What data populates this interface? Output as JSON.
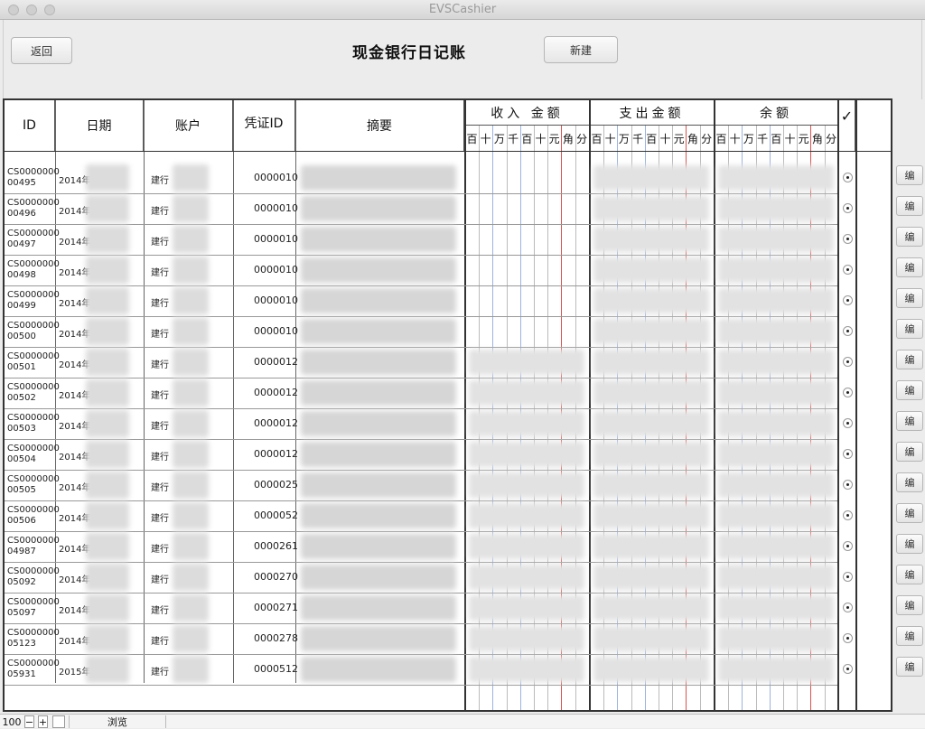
{
  "window": {
    "title": "EVSCashier"
  },
  "toolbar": {
    "back_label": "返回",
    "new_label": "新建",
    "page_title": "现金银行日记账"
  },
  "table": {
    "headers": {
      "id": "ID",
      "date": "日期",
      "account": "账户",
      "voucher": "凭证ID",
      "summary": "摘要",
      "check": "✓"
    },
    "groups": {
      "income": "收入 金额",
      "expense": "支出金额",
      "balance": "余额"
    },
    "digit_labels": [
      "百",
      "十",
      "万",
      "千",
      "百",
      "十",
      "元",
      "角",
      "分"
    ],
    "rows": [
      {
        "id_line1": "CS0000000",
        "id_line2": "00495",
        "date": "2014年",
        "account": "建行",
        "voucher": "0000010"
      },
      {
        "id_line1": "CS0000000",
        "id_line2": "00496",
        "date": "2014年",
        "account": "建行",
        "voucher": "0000010"
      },
      {
        "id_line1": "CS0000000",
        "id_line2": "00497",
        "date": "2014年",
        "account": "建行",
        "voucher": "0000010"
      },
      {
        "id_line1": "CS0000000",
        "id_line2": "00498",
        "date": "2014年",
        "account": "建行",
        "voucher": "0000010"
      },
      {
        "id_line1": "CS0000000",
        "id_line2": "00499",
        "date": "2014年",
        "account": "建行",
        "voucher": "0000010"
      },
      {
        "id_line1": "CS0000000",
        "id_line2": "00500",
        "date": "2014年",
        "account": "建行",
        "voucher": "0000010"
      },
      {
        "id_line1": "CS0000000",
        "id_line2": "00501",
        "date": "2014年",
        "account": "建行",
        "voucher": "0000012"
      },
      {
        "id_line1": "CS0000000",
        "id_line2": "00502",
        "date": "2014年",
        "account": "建行",
        "voucher": "0000012"
      },
      {
        "id_line1": "CS0000000",
        "id_line2": "00503",
        "date": "2014年",
        "account": "建行",
        "voucher": "0000012"
      },
      {
        "id_line1": "CS0000000",
        "id_line2": "00504",
        "date": "2014年",
        "account": "建行",
        "voucher": "0000012"
      },
      {
        "id_line1": "CS0000000",
        "id_line2": "00505",
        "date": "2014年",
        "account": "建行",
        "voucher": "0000025"
      },
      {
        "id_line1": "CS0000000",
        "id_line2": "00506",
        "date": "2014年",
        "account": "建行",
        "voucher": "0000052"
      },
      {
        "id_line1": "CS0000000",
        "id_line2": "04987",
        "date": "2014年",
        "account": "建行",
        "voucher": "0000261"
      },
      {
        "id_line1": "CS0000000",
        "id_line2": "05092",
        "date": "2014年",
        "account": "建行",
        "voucher": "0000270"
      },
      {
        "id_line1": "CS0000000",
        "id_line2": "05097",
        "date": "2014年",
        "account": "建行",
        "voucher": "0000271"
      },
      {
        "id_line1": "CS0000000",
        "id_line2": "05123",
        "date": "2014年",
        "account": "建行",
        "voucher": "0000278"
      },
      {
        "id_line1": "CS0000000",
        "id_line2": "05931",
        "date": "2015年",
        "account": "建行",
        "voucher": "0000512"
      }
    ],
    "edit_label": "编"
  },
  "statusbar": {
    "zoom": "100",
    "mode": "浏览"
  },
  "colors": {
    "yuan_line": "#d9534f",
    "blue_line": "#9db3e0"
  }
}
